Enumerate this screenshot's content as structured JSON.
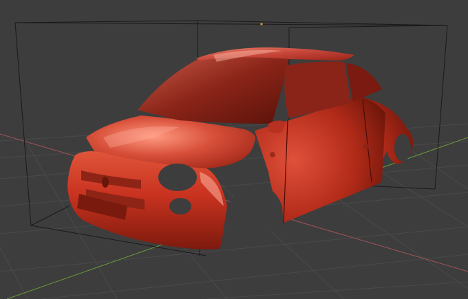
{
  "viewport": {
    "name": "3d-viewport",
    "background": "#3d3d3d",
    "grid_color": "#4a4a4a",
    "x_axis_color": "#a1535a",
    "y_axis_color": "#6a9a3a",
    "bbox_color": "#1a1a1a",
    "origin_marker_color": "#e0a020"
  },
  "model": {
    "name": "car-body-shell",
    "material_color": "#c8321f",
    "highlight_color": "#ff8a72",
    "shadow_color": "#5a1208",
    "glass_color": "#7a1a10"
  }
}
